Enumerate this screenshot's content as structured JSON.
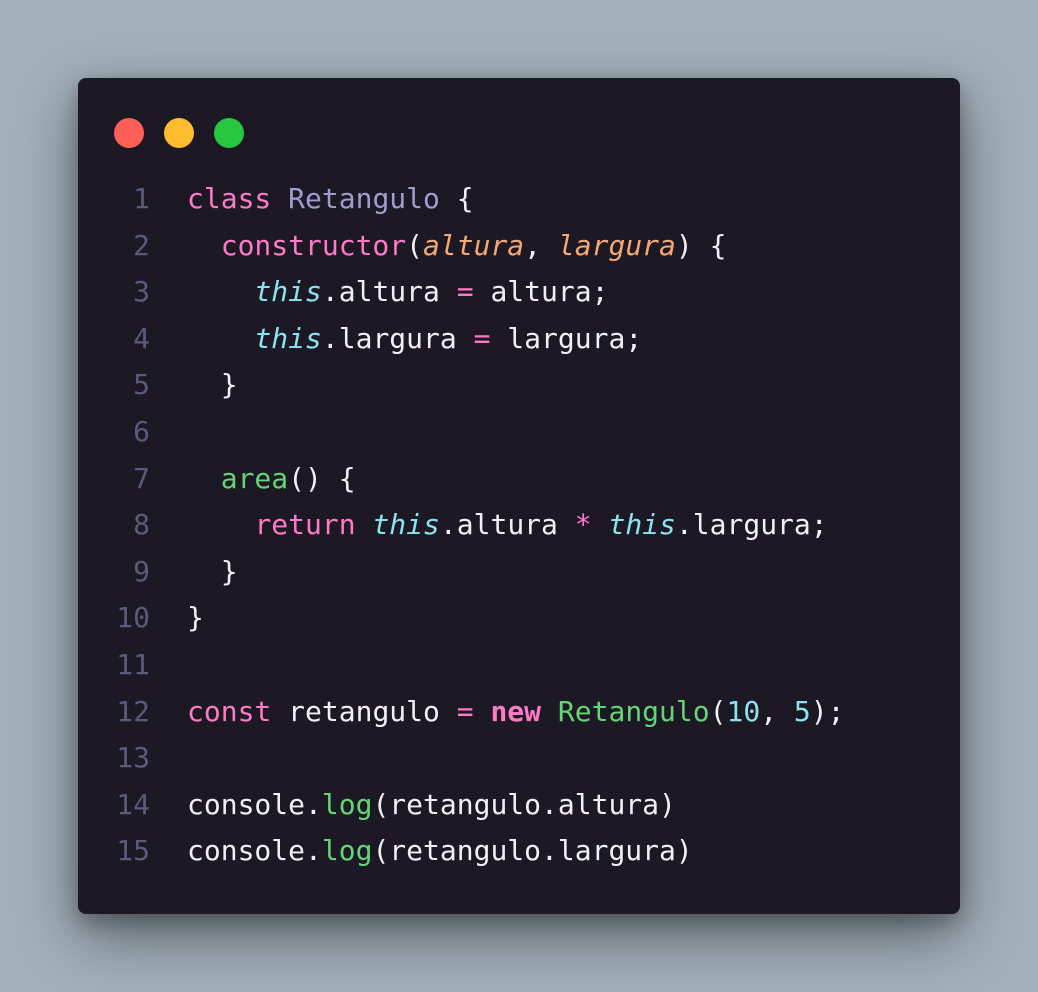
{
  "window": {
    "controls": {
      "close": "red",
      "minimize": "yellow",
      "maximize": "green"
    }
  },
  "colors": {
    "background": "#a3b0bb",
    "editor": "#1c1925",
    "keyword": "#ff79c6",
    "class_name": "#a09ccf",
    "parameter": "#f5a874",
    "this": "#8be3f0",
    "function": "#63d575",
    "number": "#8be3f0",
    "line_number": "#5c5a7a"
  },
  "code": {
    "lines": [
      {
        "n": "1",
        "tokens": [
          {
            "t": "class",
            "c": "kw"
          },
          {
            "t": " ",
            "c": "plain"
          },
          {
            "t": "Retangulo",
            "c": "cls"
          },
          {
            "t": " {",
            "c": "plain"
          }
        ]
      },
      {
        "n": "2",
        "tokens": [
          {
            "t": "  ",
            "c": "plain"
          },
          {
            "t": "constructor",
            "c": "ctor"
          },
          {
            "t": "(",
            "c": "plain"
          },
          {
            "t": "altura",
            "c": "param"
          },
          {
            "t": ", ",
            "c": "plain"
          },
          {
            "t": "largura",
            "c": "param"
          },
          {
            "t": ") {",
            "c": "plain"
          }
        ]
      },
      {
        "n": "3",
        "tokens": [
          {
            "t": "    ",
            "c": "plain"
          },
          {
            "t": "this",
            "c": "this"
          },
          {
            "t": ".altura ",
            "c": "plain"
          },
          {
            "t": "=",
            "c": "op"
          },
          {
            "t": " altura;",
            "c": "plain"
          }
        ]
      },
      {
        "n": "4",
        "tokens": [
          {
            "t": "    ",
            "c": "plain"
          },
          {
            "t": "this",
            "c": "this"
          },
          {
            "t": ".largura ",
            "c": "plain"
          },
          {
            "t": "=",
            "c": "op"
          },
          {
            "t": " largura;",
            "c": "plain"
          }
        ]
      },
      {
        "n": "5",
        "tokens": [
          {
            "t": "  }",
            "c": "plain"
          }
        ]
      },
      {
        "n": "6",
        "tokens": []
      },
      {
        "n": "7",
        "tokens": [
          {
            "t": "  ",
            "c": "plain"
          },
          {
            "t": "area",
            "c": "fn"
          },
          {
            "t": "() {",
            "c": "plain"
          }
        ]
      },
      {
        "n": "8",
        "tokens": [
          {
            "t": "    ",
            "c": "plain"
          },
          {
            "t": "return",
            "c": "kw"
          },
          {
            "t": " ",
            "c": "plain"
          },
          {
            "t": "this",
            "c": "this"
          },
          {
            "t": ".altura ",
            "c": "plain"
          },
          {
            "t": "*",
            "c": "op"
          },
          {
            "t": " ",
            "c": "plain"
          },
          {
            "t": "this",
            "c": "this"
          },
          {
            "t": ".largura;",
            "c": "plain"
          }
        ]
      },
      {
        "n": "9",
        "tokens": [
          {
            "t": "  }",
            "c": "plain"
          }
        ]
      },
      {
        "n": "10",
        "tokens": [
          {
            "t": "}",
            "c": "plain"
          }
        ]
      },
      {
        "n": "11",
        "tokens": []
      },
      {
        "n": "12",
        "tokens": [
          {
            "t": "const",
            "c": "kw"
          },
          {
            "t": " retangulo ",
            "c": "plain"
          },
          {
            "t": "=",
            "c": "op"
          },
          {
            "t": " ",
            "c": "plain"
          },
          {
            "t": "new",
            "c": "new"
          },
          {
            "t": " ",
            "c": "plain"
          },
          {
            "t": "Retangulo",
            "c": "fn"
          },
          {
            "t": "(",
            "c": "plain"
          },
          {
            "t": "10",
            "c": "num"
          },
          {
            "t": ", ",
            "c": "plain"
          },
          {
            "t": "5",
            "c": "num"
          },
          {
            "t": ");",
            "c": "plain"
          }
        ]
      },
      {
        "n": "13",
        "tokens": []
      },
      {
        "n": "14",
        "tokens": [
          {
            "t": "console.",
            "c": "plain"
          },
          {
            "t": "log",
            "c": "fn"
          },
          {
            "t": "(retangulo.altura)",
            "c": "plain"
          }
        ]
      },
      {
        "n": "15",
        "tokens": [
          {
            "t": "console.",
            "c": "plain"
          },
          {
            "t": "log",
            "c": "fn"
          },
          {
            "t": "(retangulo.largura)",
            "c": "plain"
          }
        ]
      }
    ]
  }
}
